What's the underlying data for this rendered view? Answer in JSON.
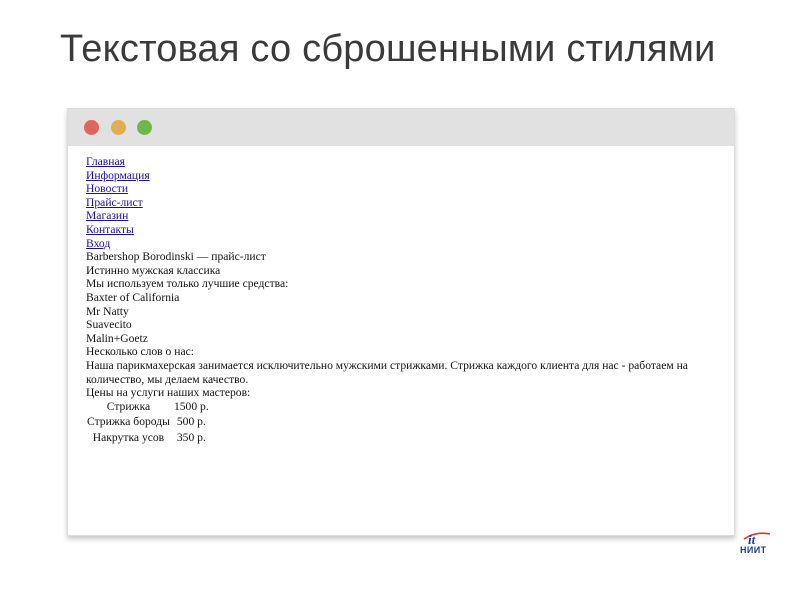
{
  "slide": {
    "title": "Текстовая со сброшенными стилями"
  },
  "browser": {
    "nav_links": [
      "Главная",
      "Информация",
      "Новости",
      "Прайс-лист",
      "Магазин",
      "Контакты",
      "Вход"
    ],
    "content": {
      "heading": "Barbershop Borodinski — прайс-лист",
      "tagline": "Истинно мужская классика",
      "products_intro": "Мы используем только лучшие средства:",
      "products": [
        "Baxter of California",
        "Mr Natty",
        "Suavecito",
        "Malin+Goetz"
      ],
      "about_heading": "Несколько слов о нас:",
      "about_text": "Наша парикмахерская занимается исключительно мужскими стрижками. Стрижка каждого клиента для нас - работаем на количество, мы делаем качество.",
      "prices_heading": "Цены на услуги наших мастеров:",
      "prices": [
        {
          "service": "Стрижка",
          "price": "1500 р."
        },
        {
          "service": "Стрижка бороды",
          "price": "500 р."
        },
        {
          "service": "Накрутка усов",
          "price": "350 р."
        }
      ]
    }
  },
  "logo": {
    "text": "НИИТ",
    "mark": "it"
  },
  "colors": {
    "dot_red": "#df6560",
    "dot_yellow": "#e2ac52",
    "dot_green": "#6cb84a",
    "link": "#1a0dab",
    "titlebar": "#e1e1e1"
  }
}
